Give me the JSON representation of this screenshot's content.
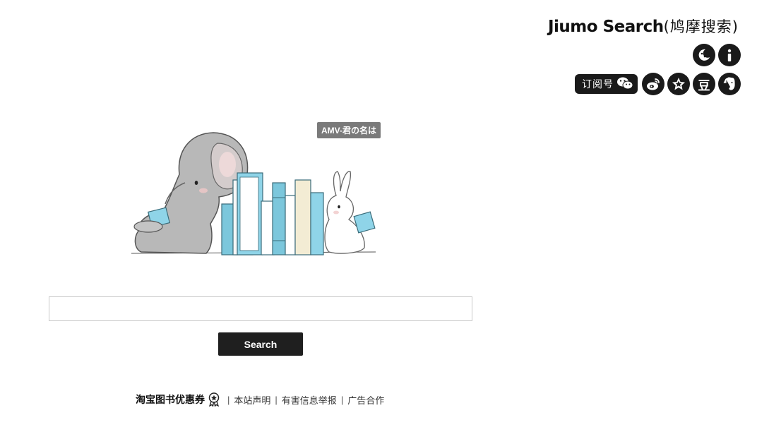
{
  "header": {
    "brand_en": "Jiumo Search",
    "brand_cn": "(鸠摩搜索)",
    "icons_row1": [
      {
        "name": "night-mode-icon"
      },
      {
        "name": "info-icon"
      }
    ],
    "subscribe_label": "订阅号",
    "icons_row2": [
      {
        "name": "wechat-icon"
      },
      {
        "name": "weibo-icon"
      },
      {
        "name": "favorite-star-icon"
      },
      {
        "name": "douban-icon"
      },
      {
        "name": "evernote-icon"
      }
    ],
    "douban_glyph": "豆"
  },
  "tooltip": {
    "text": "AMV-君の名は"
  },
  "search": {
    "value": "",
    "placeholder": "",
    "button_label": "Search"
  },
  "footer": {
    "promo_label": "淘宝图书优惠券",
    "links": [
      "本站声明",
      "有害信息举报",
      "广告合作"
    ],
    "separator": "|"
  },
  "colors": {
    "dark": "#1a1a1a",
    "book_blue": "#7cc7dc",
    "book_cream": "#f3ecd4",
    "tooltip_bg": "#7a7a7a"
  }
}
